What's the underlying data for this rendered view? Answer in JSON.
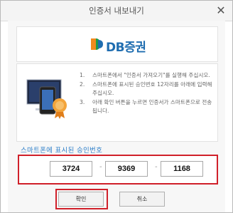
{
  "window": {
    "title": "인증서 내보내기",
    "close_icon": "close-icon"
  },
  "brand": {
    "logo_text": "DB증권",
    "logo_icon": "db-logo-mark",
    "logo_text_color": "#1f6db0"
  },
  "instructions": {
    "illustration_icon": "monitor-phone-certificate-icon",
    "steps": [
      {
        "num": "1.",
        "text": "스마트폰에서 \"인증서 가져오기\"를 실행해 주십시오."
      },
      {
        "num": "2.",
        "text": "스마트폰에 표시된 승인번호 12자리를 아래에 입력해주십시오."
      },
      {
        "num": "3.",
        "text": "아래 확인 버튼을 누르면 인증서가 스마트폰으로 전송됩니다."
      }
    ]
  },
  "auth_code": {
    "label": "스마트폰에 표시된 승인번호",
    "fields": [
      "3724",
      "9369",
      "1168"
    ],
    "separator": "-",
    "highlight_color": "#d0202a",
    "label_color": "#2e7fc9"
  },
  "buttons": {
    "confirm_label": "확인",
    "cancel_label": "취소"
  }
}
